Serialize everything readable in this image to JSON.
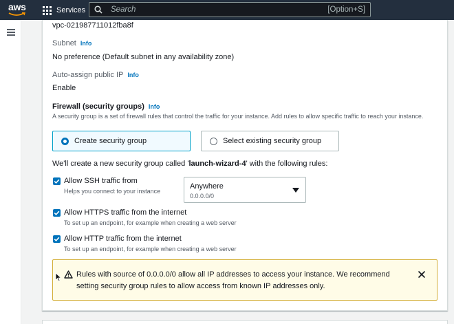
{
  "topnav": {
    "logo": "aws",
    "services_label": "Services",
    "search_placeholder": "Search",
    "search_shortcut": "[Option+S]"
  },
  "network": {
    "vpc_value": "vpc-021987711012fba8f",
    "subnet_label": "Subnet",
    "subnet_info": "Info",
    "subnet_value": "No preference (Default subnet in any availability zone)",
    "public_ip_label": "Auto-assign public IP",
    "public_ip_info": "Info",
    "public_ip_value": "Enable"
  },
  "firewall": {
    "title": "Firewall (security groups)",
    "info": "Info",
    "description": "A security group is a set of firewall rules that control the traffic for your instance. Add rules to allow specific traffic to reach your instance.",
    "options": [
      {
        "label": "Create security group",
        "selected": true
      },
      {
        "label": "Select existing security group",
        "selected": false
      }
    ],
    "create_note_prefix": "We'll create a new security group called '",
    "create_note_name": "launch-wizard-4",
    "create_note_suffix": "' with the following rules:",
    "rules": [
      {
        "label": "Allow SSH traffic from",
        "hint": "Helps you connect to your instance",
        "checked": true
      },
      {
        "label": "Allow HTTPS traffic from the internet",
        "hint": "To set up an endpoint, for example when creating a web server",
        "checked": true
      },
      {
        "label": "Allow HTTP traffic from the internet",
        "hint": "To set up an endpoint, for example when creating a web server",
        "checked": true
      }
    ],
    "ssh_source": {
      "value": "Anywhere",
      "sub": "0.0.0.0/0"
    },
    "warning": "Rules with source of 0.0.0.0/0 allow all IP addresses to access your instance. We recommend setting security group rules to allow access from known IP addresses only."
  },
  "colors": {
    "nav_bg": "#232f3e",
    "accent": "#0073bb",
    "warning_bg": "#fffce7",
    "warning_border": "#d4af37",
    "aws_orange": "#ff9900"
  }
}
